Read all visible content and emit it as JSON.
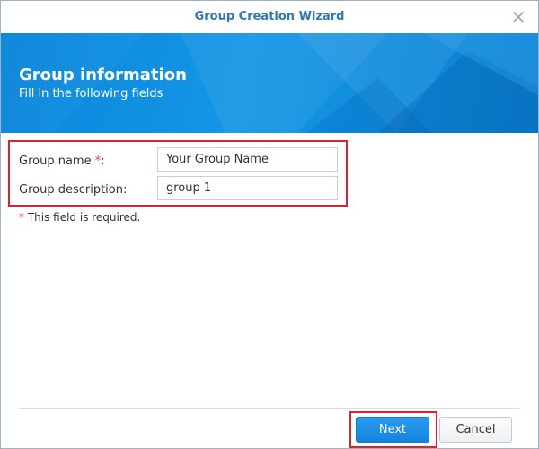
{
  "window": {
    "title": "Group Creation Wizard",
    "close_icon": "close-icon"
  },
  "banner": {
    "title": "Group information",
    "subtitle": "Fill in the following fields"
  },
  "form": {
    "group_name_label": "Group name",
    "group_name_required_mark": "*",
    "group_name_suffix": ":",
    "group_name_value": "Your Group Name",
    "group_description_label": "Group description:",
    "group_description_value": "group 1",
    "required_mark": "*",
    "required_note": " This field is required."
  },
  "footer": {
    "next_label": "Next",
    "cancel_label": "Cancel"
  },
  "colors": {
    "title": "#2f78b8",
    "banner": "#0a86da",
    "primary_button": "#1583dc",
    "highlight": "#d9232e",
    "required": "#e23b3b"
  }
}
